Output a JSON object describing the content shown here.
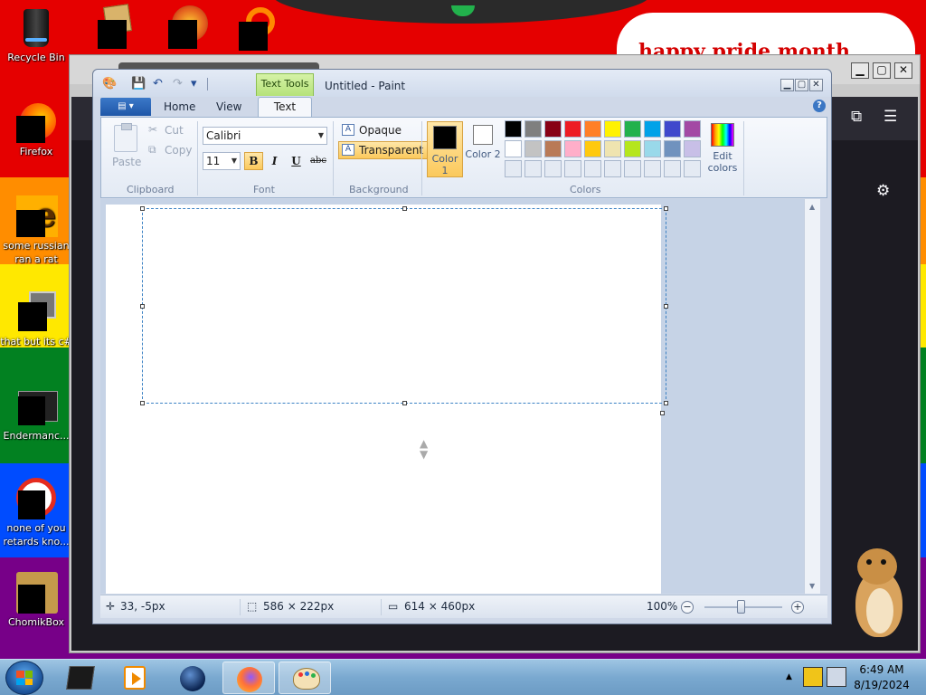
{
  "desktop": {
    "wallpaper_text": "happy pride month",
    "icons": [
      {
        "label": "Recycle Bin"
      },
      {
        "label": "Firefox"
      },
      {
        "label": "some russian ran a rat"
      },
      {
        "label": "that but its c#"
      },
      {
        "label": "Endermanc..."
      },
      {
        "label": "none of you retards kno..."
      },
      {
        "label": "ChomikBox"
      }
    ]
  },
  "background_window": {
    "controls": {
      "minimize": "▁",
      "maximize": "▢",
      "close": "✕"
    },
    "toolbar_icons": [
      "extensions-icon",
      "hamburger-menu-icon",
      "gear-icon"
    ]
  },
  "paint": {
    "title": "Untitled - Paint",
    "contextual_tab": "Text Tools",
    "quick_access": {
      "save": "💾",
      "undo": "↶",
      "redo": "↷",
      "customize": "▾"
    },
    "window_controls": {
      "minimize": "▁",
      "restore": "▢",
      "close": "✕"
    },
    "tabs": {
      "home": "Home",
      "view": "View",
      "text": "Text"
    },
    "help": "?",
    "clipboard": {
      "paste": "Paste",
      "cut": "Cut",
      "copy": "Copy",
      "group": "Clipboard"
    },
    "font": {
      "family": "Calibri",
      "size": "11",
      "bold": "B",
      "italic": "I",
      "underline": "U",
      "strike": "abc",
      "group": "Font"
    },
    "background": {
      "opaque": "Opaque",
      "transparent": "Transparent",
      "group": "Background",
      "selected": "Transparent"
    },
    "colors": {
      "color1_label": "Color 1",
      "color2_label": "Color 2",
      "color1": "#000000",
      "color2": "#ffffff",
      "edit_label": "Edit colors",
      "group": "Colors",
      "palette_row1": [
        "#000000",
        "#7f7f7f",
        "#880015",
        "#ed1c24",
        "#ff7f27",
        "#fff200",
        "#22b14c",
        "#00a2e8",
        "#3f48cc",
        "#a349a4"
      ],
      "palette_row2": [
        "#ffffff",
        "#c3c3c3",
        "#b97a57",
        "#ffaec9",
        "#ffc90e",
        "#efe4b0",
        "#b5e61d",
        "#99d9ea",
        "#7092be",
        "#c8bfe7"
      ],
      "palette_row3": [
        "#e4eaf3",
        "#e4eaf3",
        "#e4eaf3",
        "#e4eaf3",
        "#e4eaf3",
        "#e4eaf3",
        "#e4eaf3",
        "#e4eaf3",
        "#e4eaf3",
        "#e4eaf3"
      ]
    },
    "status": {
      "cursor_pos": "33, -5px",
      "selection_size": "586 × 222px",
      "canvas_size": "614 × 460px",
      "zoom": "100%",
      "zoom_out": "−",
      "zoom_in": "+"
    }
  },
  "taskbar": {
    "clock_time": "6:49 AM",
    "clock_date": "8/19/2024",
    "tray_arrow": "▲"
  }
}
